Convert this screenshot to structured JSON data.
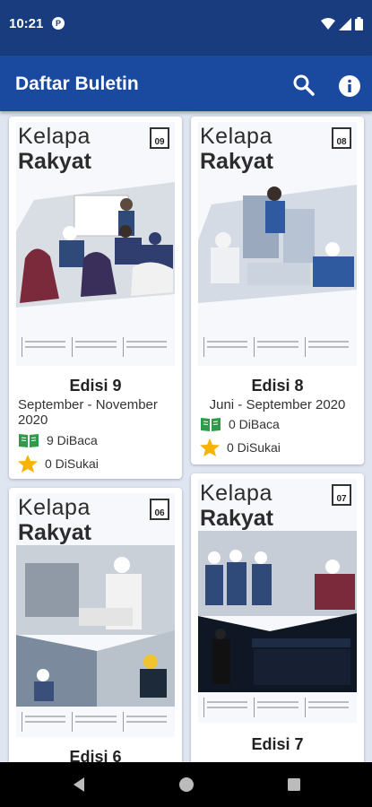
{
  "status": {
    "time": "10:21",
    "app_icon": "P"
  },
  "app_bar": {
    "title": "Daftar Buletin",
    "search_icon": "search-icon",
    "info_icon": "info-icon"
  },
  "colors": {
    "status_bar": "#183c7e",
    "app_bar": "#1a4aa0",
    "book_icon": "#2e9b4a",
    "star_icon": "#f6b400"
  },
  "bulletins": [
    {
      "cover_title1": "Kelapa",
      "cover_title2": "Rakyat",
      "cover_number": "09",
      "edition": "Edisi 9",
      "period": "September - November 2020",
      "reads": "9 DiBaca",
      "likes": "0 DiSukai"
    },
    {
      "cover_title1": "Kelapa",
      "cover_title2": "Rakyat",
      "cover_number": "08",
      "edition": "Edisi 8",
      "period": "Juni - September 2020",
      "reads": "0 DiBaca",
      "likes": "0 DiSukai"
    },
    {
      "cover_title1": "Kelapa",
      "cover_title2": "Rakyat",
      "cover_number": "06",
      "edition": "Edisi 6"
    },
    {
      "cover_title1": "Kelapa",
      "cover_title2": "Rakyat",
      "cover_number": "07",
      "edition": "Edisi 7"
    }
  ]
}
